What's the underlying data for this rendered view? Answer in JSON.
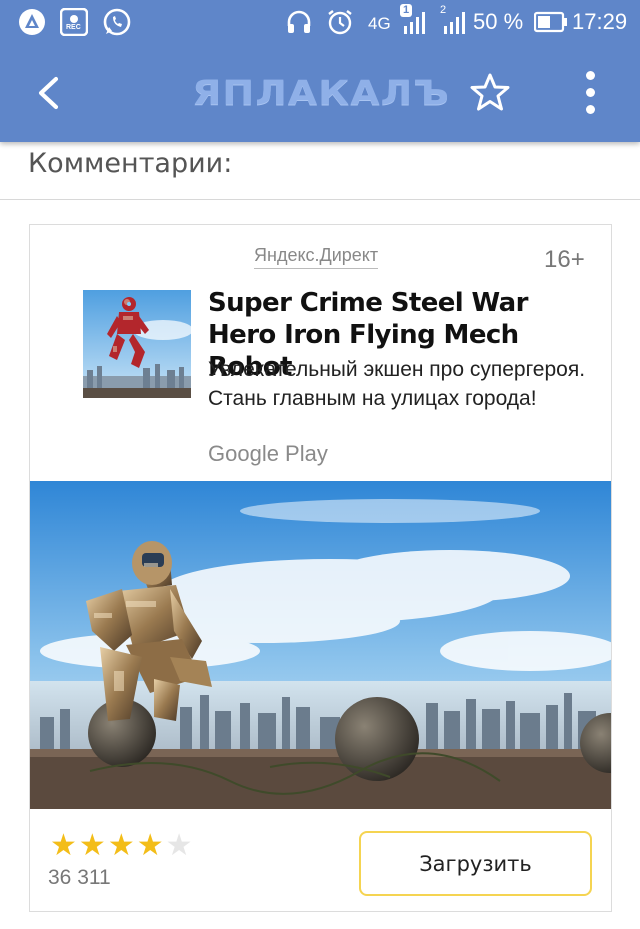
{
  "status_bar": {
    "left_icons": [
      "app-logo-icon",
      "screen-record-icon",
      "whatsapp-icon"
    ],
    "rec_label": "REC",
    "right_icons": [
      "headphones-icon",
      "alarm-icon",
      "signal-icon"
    ],
    "network": "4G",
    "sim1": "1",
    "sim2": "2",
    "battery_percent": "50 %",
    "time": "17:29"
  },
  "toolbar": {
    "logo_text": "ЯПЛАКАЛЪ",
    "icons": [
      "back-arrow-icon",
      "star-outline-icon",
      "more-vertical-icon"
    ]
  },
  "comments": {
    "title": "Комментарии:"
  },
  "ad": {
    "source": "Яндекс.Директ",
    "age": "16+",
    "title": "Super Crime Steel War Hero Iron Flying Mech Robot",
    "description": "Увлекательный экшен про супергероя. Стань главным на улицах города!",
    "store": "Google Play",
    "rating_stars": 4,
    "rating_max": 5,
    "rating_count": "36 311",
    "download_label": "Загрузить"
  },
  "colors": {
    "header_bg": "#5f86c9",
    "star_filled": "#f3bd18",
    "button_border": "#f5d451"
  }
}
